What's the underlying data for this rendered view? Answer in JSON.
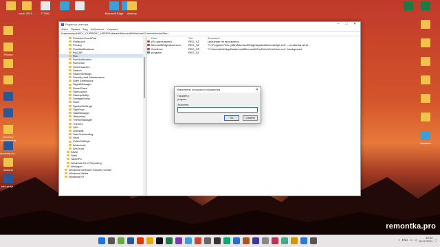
{
  "desktop": {
    "top_icons": [
      {
        "label": "",
        "type": "folder"
      },
      {
        "label": "roszh 2021 ...",
        "type": "folder"
      },
      {
        "label": "771940",
        "type": "doc"
      },
      {
        "label": "",
        "type": "misc"
      },
      {
        "label": "",
        "type": "doc"
      },
      {
        "label": "Microsoft Edge",
        "type": "misc"
      },
      {
        "label": "",
        "type": "misc"
      },
      {
        "label": "desktop",
        "type": "folder"
      }
    ],
    "left_icons": [
      {
        "label": "",
        "type": "folder"
      },
      {
        "label": "Privacy",
        "type": "folder"
      },
      {
        "label": "",
        "type": "folder"
      },
      {
        "label": "",
        "type": "folder"
      },
      {
        "label": "",
        "type": "word"
      },
      {
        "label": "",
        "type": "word"
      },
      {
        "label": "recovery environment",
        "type": "folder"
      },
      {
        "label": "recovery-en...",
        "type": "word"
      },
      {
        "label": "autorun",
        "type": "folder"
      },
      {
        "label": "add-progr...",
        "type": "word"
      }
    ],
    "right_icons": [
      {
        "label": "",
        "type": "excel"
      },
      {
        "label": "",
        "type": "excel"
      },
      {
        "label": "",
        "type": "folder"
      },
      {
        "label": "",
        "type": "folder"
      },
      {
        "label": "",
        "type": "folder"
      },
      {
        "label": "",
        "type": "folder"
      },
      {
        "label": "",
        "type": "folder"
      },
      {
        "label": "",
        "type": "folder"
      },
      {
        "label": "Корзина",
        "type": "misc"
      }
    ],
    "watermark": "remontka.pro"
  },
  "registry": {
    "title": "Редактор реестра",
    "menu": [
      "Файл",
      "Правка",
      "Вид",
      "Избранное",
      "Справка"
    ],
    "address": "Компьютер\\HKEY_CURRENT_USER\\Software\\Microsoft\\Windows\\CurrentVersion\\Run",
    "tree": [
      {
        "label": "PrecisionTouchPad",
        "indent": 2
      },
      {
        "label": "Prelaunch",
        "indent": 2
      },
      {
        "label": "Privacy",
        "indent": 2
      },
      {
        "label": "PushNotifications",
        "indent": 2
      },
      {
        "label": "RADAR",
        "indent": 2
      },
      {
        "label": "Run",
        "indent": 2,
        "selected": true
      },
      {
        "label": "RunNotification",
        "indent": 2
      },
      {
        "label": "RunOnce",
        "indent": 2
      },
      {
        "label": "Screensavers",
        "indent": 2
      },
      {
        "label": "Search",
        "indent": 2
      },
      {
        "label": "SearchSettings",
        "indent": 2
      },
      {
        "label": "Security and Maintenance",
        "indent": 2
      },
      {
        "label": "Shell Extensions",
        "indent": 2
      },
      {
        "label": "SignalManager",
        "indent": 2
      },
      {
        "label": "SmartGlass",
        "indent": 2
      },
      {
        "label": "StartLayout",
        "indent": 2
      },
      {
        "label": "StartupNotify",
        "indent": 2
      },
      {
        "label": "StorageSense",
        "indent": 2
      },
      {
        "label": "Store",
        "indent": 2
      },
      {
        "label": "SystemSettings",
        "indent": 2
      },
      {
        "label": "TaskFlow",
        "indent": 2
      },
      {
        "label": "TaskManager",
        "indent": 2
      },
      {
        "label": "Telephony",
        "indent": 2
      },
      {
        "label": "ThemeManager",
        "indent": 2
      },
      {
        "label": "Themes",
        "indent": 2
      },
      {
        "label": "UFH",
        "indent": 2
      },
      {
        "label": "Uninstall",
        "indent": 2
      },
      {
        "label": "UserOnboarding",
        "indent": 2
      },
      {
        "label": "Vault",
        "indent": 2
      },
      {
        "label": "VideoSettings",
        "indent": 2
      },
      {
        "label": "Webcheck",
        "indent": 2
      },
      {
        "label": "WinTrust",
        "indent": 2
      },
      {
        "label": "DWM",
        "indent": 1
      },
      {
        "label": "Shell",
        "indent": 1
      },
      {
        "label": "TabletPC",
        "indent": 1
      },
      {
        "label": "Windows Error Reporting",
        "indent": 1
      },
      {
        "label": "Winlogon",
        "indent": 1
      },
      {
        "label": "Windows Defender Security Center",
        "indent": 0
      },
      {
        "label": "Windows Media",
        "indent": 0
      },
      {
        "label": "Windows NT",
        "indent": 0
      }
    ],
    "columns": [
      "Имя",
      "Тип",
      "Значение"
    ],
    "values": [
      {
        "name": "(По умолчанию)",
        "type": "REG_SZ",
        "data": "(значение не присвоено)",
        "kind": "sz"
      },
      {
        "name": "MicrosoftEdgeAutoLaun...",
        "type": "REG_SZ",
        "data": "\"C:\\Program Files (x86)\\Microsoft\\Edge\\Application\\msedge.exe\" --no-startup-wind...",
        "kind": "sz"
      },
      {
        "name": "OneDrive",
        "type": "REG_SZ",
        "data": "\"C:\\Users\\test\\AppData\\Local\\Microsoft\\OneDrive\\OneDrive.exe\" /background",
        "kind": "sz"
      },
      {
        "name": "program",
        "type": "REG_SZ",
        "data": "",
        "kind": "bin"
      }
    ]
  },
  "dialog": {
    "title": "Изменение строкового параметра",
    "param_label": "Параметр:",
    "param_value": "program",
    "value_label": "Значение:",
    "value_value": "",
    "ok": "ОК",
    "cancel": "Отмена"
  },
  "taskbar": {
    "time": "10:23",
    "date": "28.12.2021",
    "lang": "ENG"
  }
}
